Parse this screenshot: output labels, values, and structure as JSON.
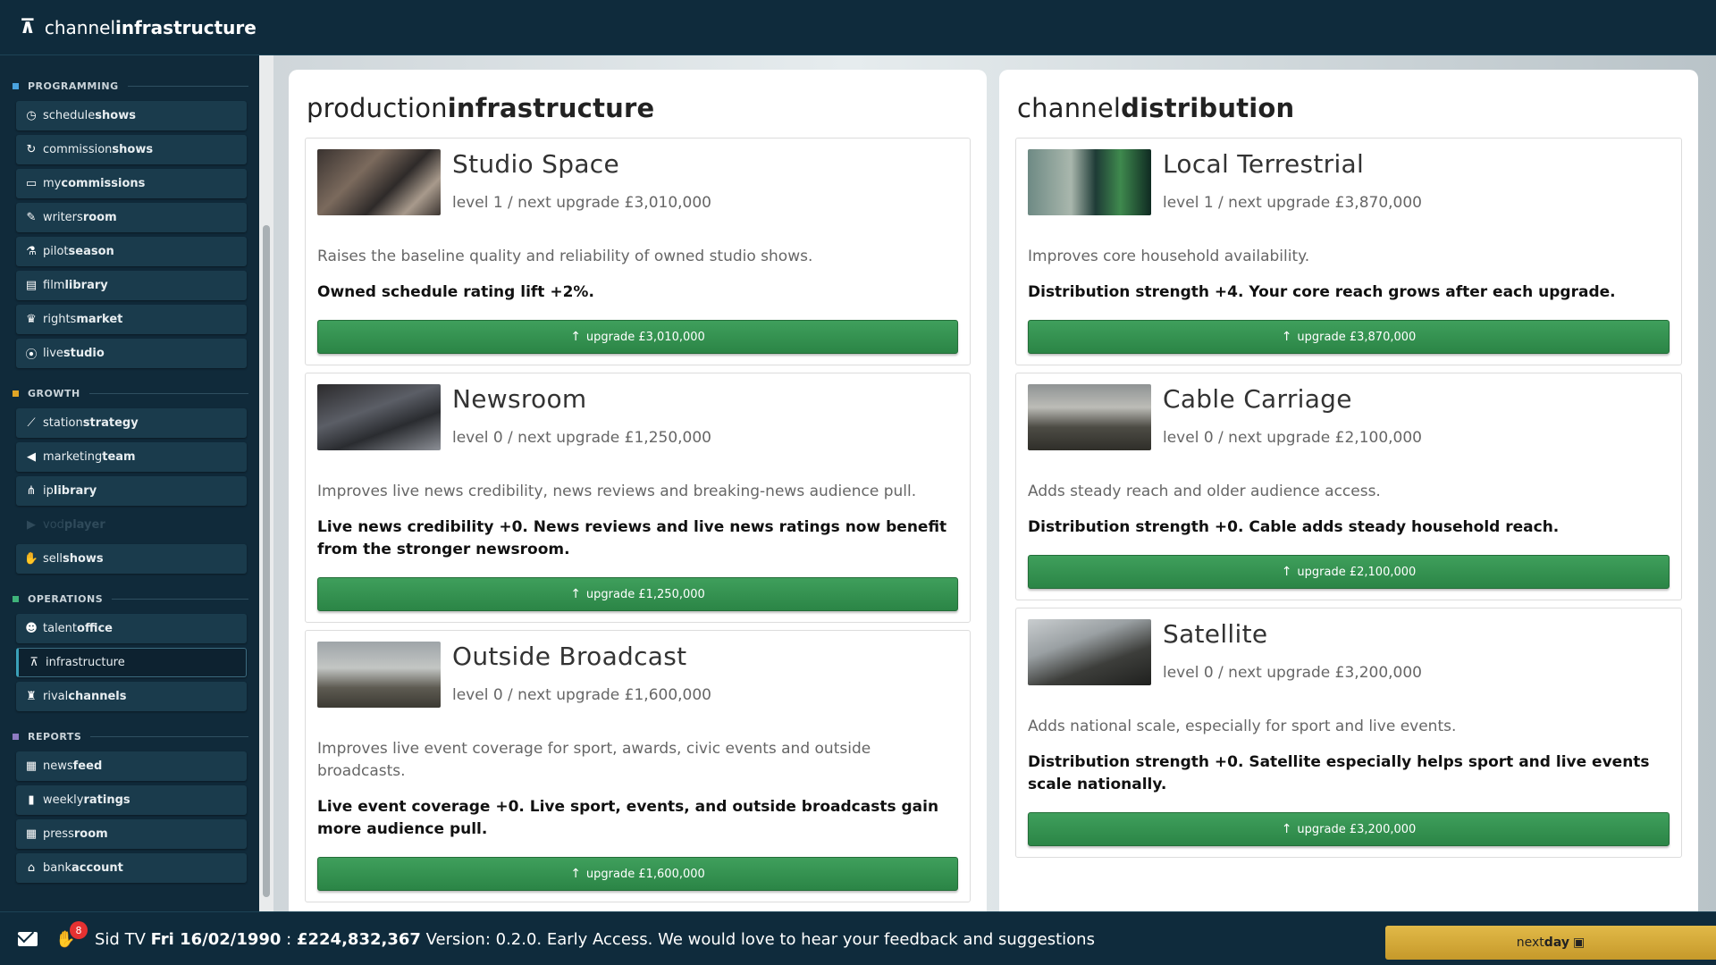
{
  "app": {
    "title_light": "channel",
    "title_bold": "infrastructure"
  },
  "sidebar": {
    "sections": [
      {
        "key": "programming",
        "label": "PROGRAMMING",
        "color": "#4aa3df",
        "items": [
          {
            "light": "schedule",
            "bold": "shows",
            "icon": "clock-icon",
            "glyph": "◷"
          },
          {
            "light": "commission",
            "bold": "shows",
            "icon": "refresh-icon",
            "glyph": "↻"
          },
          {
            "light": "my",
            "bold": "commissions",
            "icon": "monitor-icon",
            "glyph": "▭"
          },
          {
            "light": "writers",
            "bold": "room",
            "icon": "pen-icon",
            "glyph": "✎"
          },
          {
            "light": "pilot",
            "bold": "season",
            "icon": "flask-icon",
            "glyph": "⚗"
          },
          {
            "light": "film",
            "bold": "library",
            "icon": "film-icon",
            "glyph": "▤"
          },
          {
            "light": "rights",
            "bold": "market",
            "icon": "trophy-icon",
            "glyph": "♛"
          },
          {
            "light": "live",
            "bold": "studio",
            "icon": "broadcast-icon",
            "glyph": "⦿"
          }
        ]
      },
      {
        "key": "growth",
        "label": "GROWTH",
        "color": "#e0a526",
        "items": [
          {
            "light": "station",
            "bold": "strategy",
            "icon": "chart-line-icon",
            "glyph": "⟋"
          },
          {
            "light": "marketing",
            "bold": "team",
            "icon": "megaphone-icon",
            "glyph": "◀"
          },
          {
            "light": "ip",
            "bold": "library",
            "icon": "share-icon",
            "glyph": "⋔"
          },
          {
            "light": "vod",
            "bold": "player",
            "icon": "play-icon",
            "glyph": "▶",
            "disabled": true
          },
          {
            "light": "sell",
            "bold": "shows",
            "icon": "handshake-icon",
            "glyph": "✋"
          }
        ]
      },
      {
        "key": "operations",
        "label": "OPERATIONS",
        "color": "#3fb37a",
        "items": [
          {
            "light": "talent",
            "bold": "office",
            "icon": "people-icon",
            "glyph": "☻"
          },
          {
            "light": "infrastructure",
            "bold": "",
            "icon": "tower-icon",
            "glyph": "⊼",
            "active": true
          },
          {
            "light": "rival",
            "bold": "channels",
            "icon": "chess-icon",
            "glyph": "♜"
          }
        ]
      },
      {
        "key": "reports",
        "label": "REPORTS",
        "color": "#8e7cc3",
        "items": [
          {
            "light": "news",
            "bold": "feed",
            "icon": "newspaper-icon",
            "glyph": "▦"
          },
          {
            "light": "weekly",
            "bold": "ratings",
            "icon": "bar-chart-icon",
            "glyph": "▮"
          },
          {
            "light": "press",
            "bold": "room",
            "icon": "newspaper-icon",
            "glyph": "▦"
          },
          {
            "light": "bank",
            "bold": "account",
            "icon": "bank-icon",
            "glyph": "⌂"
          }
        ]
      }
    ]
  },
  "production": {
    "heading_light": "production",
    "heading_bold": "infrastructure",
    "cards": [
      {
        "name": "Studio Space",
        "level": "level 1 / next upgrade £3,010,000",
        "desc": "Raises the baseline quality and reliability of owned studio shows.",
        "effect": "Owned schedule rating lift +2%.",
        "button": "upgrade £3,010,000",
        "thumb": "studio"
      },
      {
        "name": "Newsroom",
        "level": "level 0 / next upgrade £1,250,000",
        "desc": "Improves live news credibility, news reviews and breaking-news audience pull.",
        "effect": "Live news credibility +0. News reviews and live news ratings now benefit from the stronger newsroom.",
        "button": "upgrade £1,250,000",
        "thumb": "newsroom"
      },
      {
        "name": "Outside Broadcast",
        "level": "level 0 / next upgrade £1,600,000",
        "desc": "Improves live event coverage for sport, awards, civic events and outside broadcasts.",
        "effect": "Live event coverage +0. Live sport, events, and outside broadcasts gain more audience pull.",
        "button": "upgrade £1,600,000",
        "thumb": "ob"
      }
    ]
  },
  "distribution": {
    "heading_light": "channel",
    "heading_bold": "distribution",
    "cards": [
      {
        "name": "Local Terrestrial",
        "level": "level 1 / next upgrade £3,870,000",
        "desc": "Improves core household availability.",
        "effect": "Distribution strength +4. Your core reach grows after each upgrade.",
        "button": "upgrade £3,870,000",
        "thumb": "terrestrial"
      },
      {
        "name": "Cable Carriage",
        "level": "level 0 / next upgrade £2,100,000",
        "desc": "Adds steady reach and older audience access.",
        "effect": "Distribution strength +0. Cable adds steady household reach.",
        "button": "upgrade £2,100,000",
        "thumb": "cable"
      },
      {
        "name": "Satellite",
        "level": "level 0 / next upgrade £3,200,000",
        "desc": "Adds national scale, especially for sport and live events.",
        "effect": "Distribution strength +0. Satellite especially helps sport and live events scale nationally.",
        "button": "upgrade £3,200,000",
        "thumb": "satellite"
      }
    ]
  },
  "bottom": {
    "badge_count": "8",
    "channel": "Sid TV",
    "date": "Fri 16/02/1990",
    "separator": ":",
    "balance": "£224,832,367",
    "version": "Version: 0.2.0. Early Access. We would love to hear your feedback and suggestions",
    "next_light": "next",
    "next_bold": "day"
  },
  "colors": {
    "upgrade_green": "#2f8f4e",
    "next_day_gold": "#d4a93a",
    "sidebar_bg": "#102a3a"
  }
}
